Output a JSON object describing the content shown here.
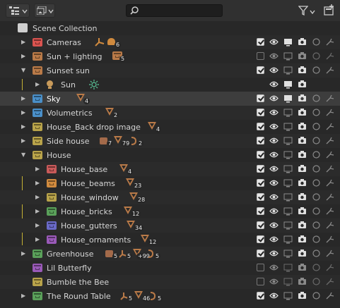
{
  "toolbar": {
    "display_mode_icon": "outliner-display-icon",
    "filter_icon": "filter-icon",
    "search_placeholder": "",
    "new_collection_icon": "new-collection-icon"
  },
  "scene_collection": {
    "label": "Scene Collection"
  },
  "rows": [
    {
      "label": "Cameras",
      "icon_color": "#d9534f",
      "counts": [
        "6"
      ],
      "checked": true
    },
    {
      "label": "Sun + lighting",
      "icon_color": "#b97a48",
      "counts": [
        "5"
      ],
      "checked": false
    },
    {
      "label": "Sunset sun",
      "icon_color": "#b97a48",
      "counts": [],
      "checked": true
    },
    {
      "label": "Sun",
      "counts": []
    },
    {
      "label": "Sky",
      "icon_color": "#4a8fc8",
      "counts": [
        "4"
      ],
      "checked": true
    },
    {
      "label": "Volumetrics",
      "icon_color": "#4a8fc8",
      "counts": [
        "2"
      ],
      "checked": true
    },
    {
      "label": "House_Back drop image",
      "icon_color": "#b8a34a",
      "counts": [
        "4"
      ],
      "checked": true
    },
    {
      "label": "Side house",
      "icon_color": "#b8a34a",
      "counts": [
        "7",
        "79",
        "2"
      ],
      "checked": true
    },
    {
      "label": "House",
      "icon_color": "#b8a34a",
      "counts": [],
      "checked": true
    },
    {
      "label": "House_base",
      "icon_color": "#c85a5a",
      "counts": [
        "4"
      ],
      "checked": true
    },
    {
      "label": "House_beams",
      "icon_color": "#d08a3e",
      "counts": [
        "23"
      ],
      "checked": true
    },
    {
      "label": "House_window",
      "icon_color": "#b8a34a",
      "counts": [
        "28"
      ],
      "checked": true
    },
    {
      "label": "House_bricks",
      "icon_color": "#5aa05a",
      "counts": [
        "12"
      ],
      "checked": true
    },
    {
      "label": "House_gutters",
      "icon_color": "#6a6ac8",
      "counts": [
        "34"
      ],
      "checked": true
    },
    {
      "label": "House_ornaments",
      "icon_color": "#9a5ab8",
      "counts": [
        "12"
      ],
      "checked": true
    },
    {
      "label": "Greenhouse",
      "icon_color": "#5aa05a",
      "counts": [
        "5",
        "5",
        "+99",
        "5"
      ],
      "checked": true
    },
    {
      "label": "Lil Butterfly",
      "icon_color": "#9a5ab8",
      "counts": [],
      "checked": false
    },
    {
      "label": "Bumble the Bee",
      "icon_color": "#b8a34a",
      "counts": [],
      "checked": false
    },
    {
      "label": "The Round Table",
      "icon_color": "#5aa05a",
      "counts": [
        "5",
        "46",
        "5"
      ],
      "checked": true
    }
  ]
}
